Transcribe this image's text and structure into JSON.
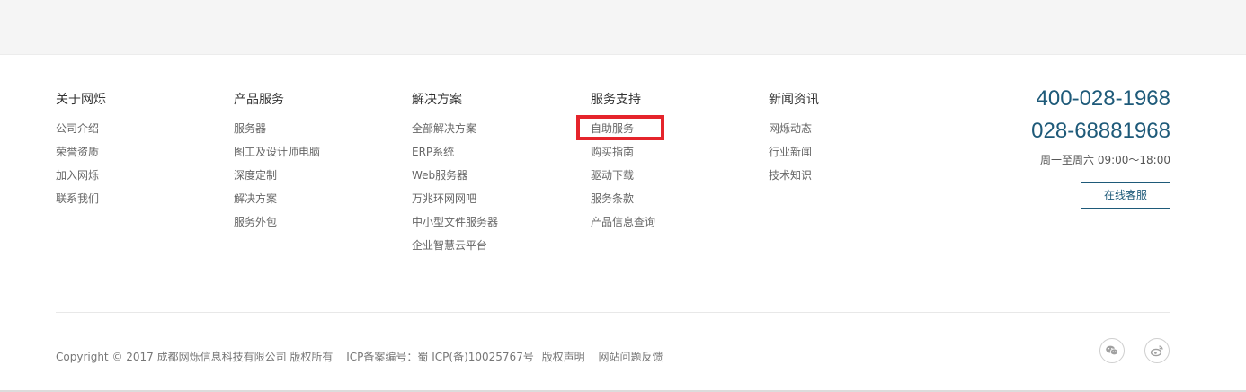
{
  "columns": [
    {
      "title": "关于网烁",
      "items": [
        "公司介绍",
        "荣誉资质",
        "加入网烁",
        "联系我们"
      ]
    },
    {
      "title": "产品服务",
      "items": [
        "服务器",
        "图工及设计师电脑",
        "深度定制",
        "解决方案",
        "服务外包"
      ]
    },
    {
      "title": "解决方案",
      "items": [
        "全部解决方案",
        "ERP系统",
        "Web服务器",
        "万兆环网网吧",
        "中小型文件服务器",
        "企业智慧云平台"
      ]
    },
    {
      "title": "服务支持",
      "items": [
        "自助服务",
        "购买指南",
        "驱动下载",
        "服务条款",
        "产品信息查询"
      ]
    },
    {
      "title": "新闻资讯",
      "items": [
        "网烁动态",
        "行业新闻",
        "技术知识"
      ]
    }
  ],
  "contact": {
    "phone1": "400-028-1968",
    "phone2": "028-68881968",
    "hours": "周一至周六 09:00～18:00",
    "service_button": "在线客服"
  },
  "bottom": {
    "copyright": "Copyright © 2017 成都网烁信息科技有限公司 版权所有",
    "icp": "ICP备案编号：蜀 ICP(备)10025767号",
    "statement": "版权声明",
    "feedback": "网站问题反馈"
  },
  "social": [
    "wechat-icon",
    "weibo-icon"
  ],
  "colors": {
    "accent": "#1e5a79",
    "highlight": "#e5242b",
    "top_band": "#f5f5f5"
  }
}
